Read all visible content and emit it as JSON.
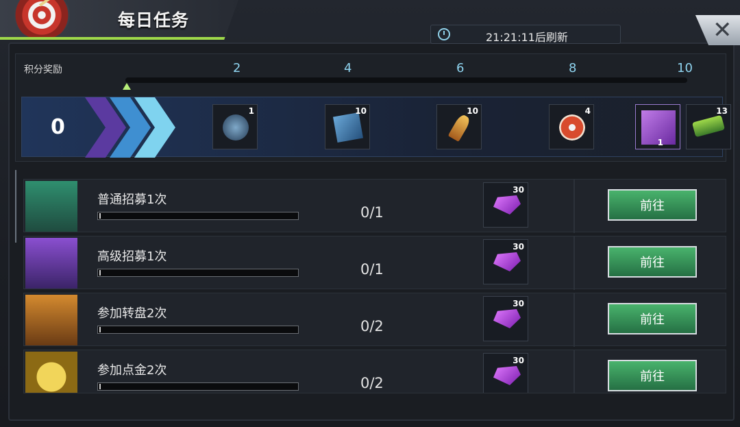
{
  "header": {
    "title": "每日任务",
    "timer": "21:21:11后刷新",
    "close_label": "✕"
  },
  "progress": {
    "label": "积分奖励",
    "ticks": [
      "2",
      "4",
      "6",
      "8",
      "10"
    ],
    "score": "0",
    "rewards": [
      {
        "icon": "coin-icon",
        "count": "1"
      },
      {
        "icon": "ticket-icon",
        "count": "10"
      },
      {
        "icon": "bullet-icon",
        "count": "10"
      },
      {
        "icon": "chip-icon",
        "count": "4"
      },
      {
        "icon": "card-icon",
        "count": "1"
      },
      {
        "icon": "gun-icon",
        "count": "13"
      }
    ]
  },
  "tasks": [
    {
      "name": "普通招募1次",
      "progress": "0/1",
      "reward_count": "30",
      "button": "前往"
    },
    {
      "name": "高级招募1次",
      "progress": "0/1",
      "reward_count": "30",
      "button": "前往"
    },
    {
      "name": "参加转盘2次",
      "progress": "0/2",
      "reward_count": "30",
      "button": "前往"
    },
    {
      "name": "参加点金2次",
      "progress": "0/2",
      "reward_count": "30",
      "button": "前往"
    }
  ],
  "colors": {
    "accent": "#8fd4f0",
    "button_green": "#3f9a5c",
    "gem": "#b24de6"
  }
}
